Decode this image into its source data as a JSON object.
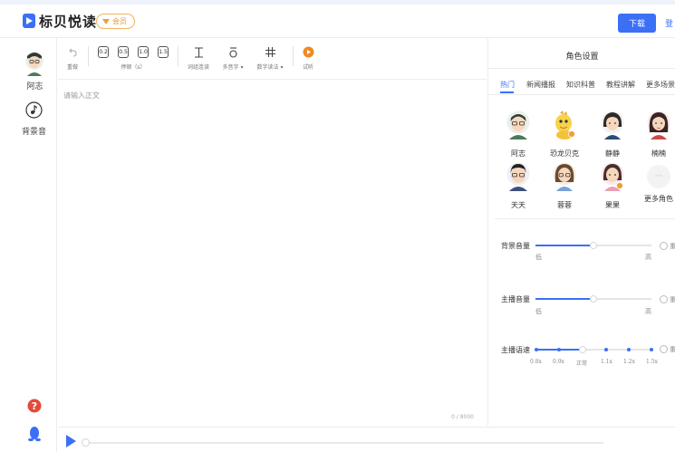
{
  "app": {
    "brand": "标贝悦读",
    "vip_badge": "会员",
    "download_label": "下载",
    "login_label": "登"
  },
  "sidebar": {
    "speaker_name": "阿志",
    "bgm_label": "背景音"
  },
  "toolbar": {
    "undo_label": "重做",
    "pause_values": [
      "0.2",
      "0.5",
      "1.0",
      "1.5"
    ],
    "pause_label": "停顿（s）",
    "continuous_label": "词组连读",
    "polyphone_label": "多音字",
    "number_label": "数字读法",
    "preview_label": "试听"
  },
  "editor": {
    "placeholder": "请输入正文",
    "counter": "0 / 8000"
  },
  "right_panel": {
    "title": "角色设置",
    "tabs": [
      "热门",
      "新闻播报",
      "知识科普",
      "教程讲解",
      "更多场景>"
    ],
    "active_tab": "热门",
    "roles": [
      {
        "name": "阿志",
        "icon": "male-glasses-avatar"
      },
      {
        "name": "恐龙贝克",
        "icon": "dinosaur-avatar"
      },
      {
        "name": "静静",
        "icon": "female-short-hair-avatar"
      },
      {
        "name": "楠楠",
        "icon": "female-long-hair-avatar"
      },
      {
        "name": "天天",
        "icon": "male-young-avatar"
      },
      {
        "name": "蓉蓉",
        "icon": "female-glasses-avatar"
      },
      {
        "name": "果果",
        "icon": "girl-avatar"
      },
      {
        "name": "更多角色",
        "icon": "more-icon"
      }
    ],
    "bg_volume": {
      "label": "背景音量",
      "low": "低",
      "high": "高",
      "value": 0.5,
      "reset": "重置"
    },
    "host_volume": {
      "label": "主播音量",
      "low": "低",
      "high": "高",
      "value": 0.5,
      "reset": "重置"
    },
    "speed": {
      "label": "主播语速",
      "ticks": [
        "0.8x",
        "0.9x",
        "正常",
        "1.1x",
        "1.2x",
        "1.5x"
      ],
      "value": "正常",
      "reset": "重置"
    }
  },
  "colors": {
    "accent": "#3b6ff5",
    "vip": "#e6a23c"
  }
}
